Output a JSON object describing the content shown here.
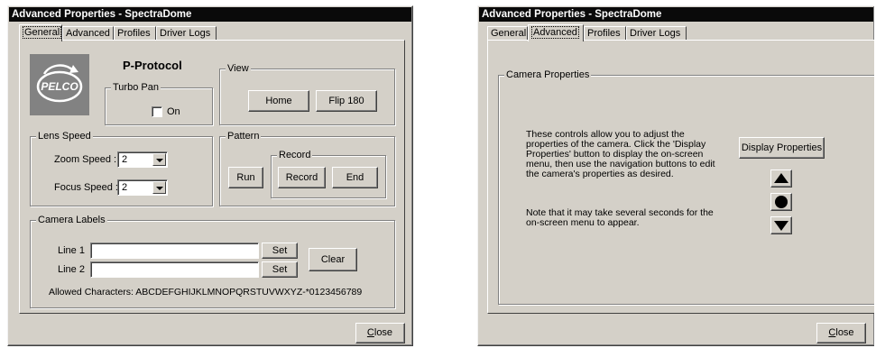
{
  "left_window": {
    "title": "Advanced Properties - SpectraDome",
    "tabs": [
      {
        "label": "General",
        "active": true
      },
      {
        "label": "Advanced",
        "active": false
      },
      {
        "label": "Profiles",
        "active": false
      },
      {
        "label": "Driver Logs",
        "active": false
      }
    ],
    "logo_text": "PELCO",
    "protocol": "P-Protocol",
    "turbo_pan": {
      "legend": "Turbo Pan",
      "checkbox_label": "On",
      "checked": false
    },
    "view": {
      "legend": "View",
      "home": "Home",
      "flip": "Flip 180"
    },
    "lens_speed": {
      "legend": "Lens Speed",
      "zoom_label": "Zoom Speed :",
      "zoom_value": "2",
      "focus_label": "Focus Speed :",
      "focus_value": "2"
    },
    "pattern": {
      "legend": "Pattern",
      "run": "Run",
      "record_legend": "Record",
      "record": "Record",
      "end": "End"
    },
    "camera_labels": {
      "legend": "Camera Labels",
      "line1_label": "Line 1",
      "line1_value": "",
      "line2_label": "Line 2",
      "line2_value": "",
      "set1": "Set",
      "set2": "Set",
      "clear": "Clear",
      "allowed": "Allowed Characters: ABCDEFGHIJKLMNOPQRSTUVWXYZ-*0123456789"
    },
    "close_button": "Close"
  },
  "right_window": {
    "title": "Advanced Properties - SpectraDome",
    "tabs": [
      {
        "label": "General",
        "active": false
      },
      {
        "label": "Advanced",
        "active": true
      },
      {
        "label": "Profiles",
        "active": false
      },
      {
        "label": "Driver Logs",
        "active": false
      }
    ],
    "camera_properties": {
      "legend": "Camera Properties",
      "description": "These controls allow you to adjust the properties of the camera.  Click the 'Display Properties' button to display the on-screen menu, then use the navigation buttons to edit the camera's properties as desired.",
      "note": "Note that it may take several seconds for the on-screen menu to appear.",
      "display_button": "Display Properties"
    },
    "close_button": "Close"
  }
}
